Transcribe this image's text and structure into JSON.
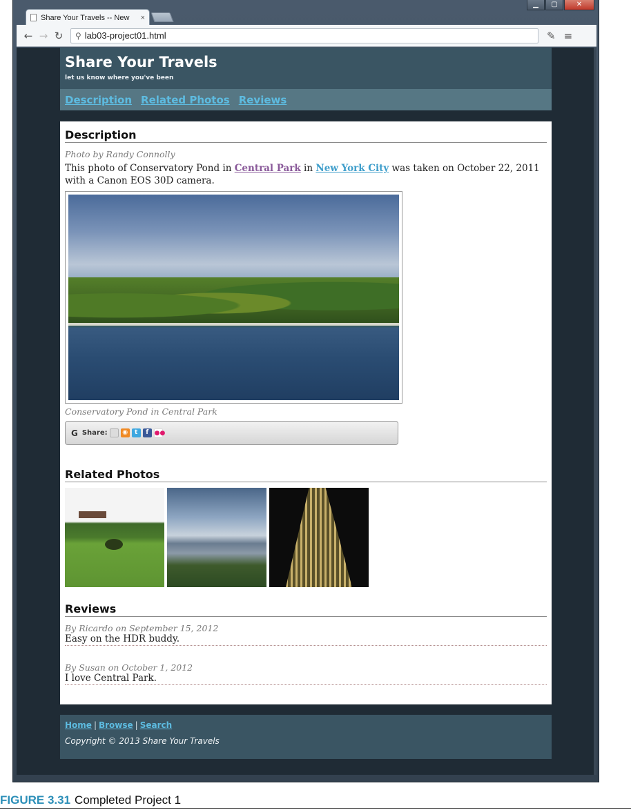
{
  "browser": {
    "tab_title": "Share Your Travels -- New",
    "tab_close": "×",
    "url": "lab03-project01.html",
    "controls": {
      "minimize": "▁",
      "maximize": "▢",
      "close": "✕"
    }
  },
  "header": {
    "title": "Share Your Travels",
    "tagline": "let us know where you've been",
    "nav": [
      "Description",
      "Related Photos",
      "Reviews"
    ]
  },
  "description": {
    "heading": "Description",
    "byline": "Photo by Randy Connolly",
    "text_before": "This photo of Conservatory Pond in ",
    "link1": "Central Park",
    "text_mid": " in ",
    "link2": "New York City",
    "text_after": " was taken on October 22, 2011 with a Canon EOS 30D camera.",
    "caption": "Conservatory Pond in Central Park",
    "share_label": "Share:"
  },
  "related": {
    "heading": "Related Photos"
  },
  "reviews": {
    "heading": "Reviews",
    "items": [
      {
        "by": "By Ricardo on September 15, 2012",
        "text": "Easy on the HDR buddy."
      },
      {
        "by": "By Susan on October 1, 2012",
        "text": "I love Central Park."
      }
    ]
  },
  "footer": {
    "links": [
      "Home",
      "Browse",
      "Search"
    ],
    "separator": "|",
    "copyright": "Copyright © 2013 Share Your Travels"
  },
  "figure": {
    "number": "FIGURE 3.31",
    "title": "Completed Project 1"
  },
  "colors": {
    "header_bg": "#3a5563",
    "nav_bg": "#567784",
    "link": "#5dbbe0",
    "page_bg": "#1f2b35"
  }
}
